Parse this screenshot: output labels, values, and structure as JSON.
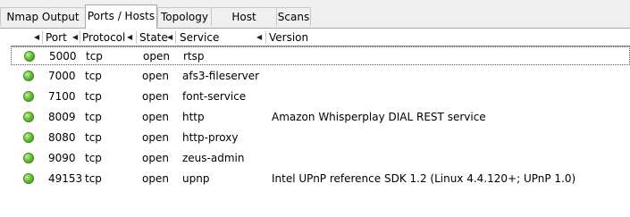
{
  "tabs": [
    {
      "label": "Nmap Output",
      "active": false
    },
    {
      "label": "Ports / Hosts",
      "active": true
    },
    {
      "label": "Topology",
      "active": false
    },
    {
      "label": "Host Details",
      "active": false
    },
    {
      "label": "Scans",
      "active": false
    }
  ],
  "table": {
    "columns": [
      "Port",
      "Protocol",
      "State",
      "Service",
      "Version"
    ],
    "rows": [
      {
        "port": "5000",
        "protocol": "tcp",
        "state": "open",
        "service": "rtsp",
        "version": "",
        "status_color": "#5cb82e"
      },
      {
        "port": "7000",
        "protocol": "tcp",
        "state": "open",
        "service": "afs3-fileserver",
        "version": "",
        "status_color": "#5cb82e"
      },
      {
        "port": "7100",
        "protocol": "tcp",
        "state": "open",
        "service": "font-service",
        "version": "",
        "status_color": "#5cb82e"
      },
      {
        "port": "8009",
        "protocol": "tcp",
        "state": "open",
        "service": "http",
        "version": "Amazon Whisperplay DIAL REST service",
        "status_color": "#5cb82e"
      },
      {
        "port": "8080",
        "protocol": "tcp",
        "state": "open",
        "service": "http-proxy",
        "version": "",
        "status_color": "#5cb82e"
      },
      {
        "port": "9090",
        "protocol": "tcp",
        "state": "open",
        "service": "zeus-admin",
        "version": "",
        "status_color": "#5cb82e"
      },
      {
        "port": "49153",
        "protocol": "tcp",
        "state": "open",
        "service": "upnp",
        "version": "Intel UPnP reference SDK 1.2 (Linux 4.4.120+; UPnP 1.0)",
        "status_color": "#5cb82e"
      }
    ]
  }
}
